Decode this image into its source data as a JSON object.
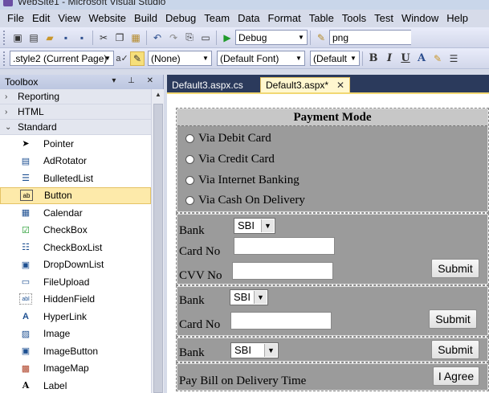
{
  "window": {
    "title": "WebSite1 - Microsoft Visual Studio"
  },
  "menu": [
    "File",
    "Edit",
    "View",
    "Website",
    "Build",
    "Debug",
    "Team",
    "Data",
    "Format",
    "Table",
    "Tools",
    "Test",
    "Window",
    "Help"
  ],
  "toolbar1": {
    "configuration": "Debug",
    "find": "png"
  },
  "toolbar2": {
    "style": ".style2 (Current Page)",
    "block_format": "(None)",
    "font": "(Default Font)",
    "size": "(Default"
  },
  "toolbox": {
    "title": "Toolbox",
    "categories": [
      "Reporting",
      "HTML",
      "Standard"
    ],
    "items": [
      "Pointer",
      "AdRotator",
      "BulletedList",
      "Button",
      "Calendar",
      "CheckBox",
      "CheckBoxList",
      "DropDownList",
      "FileUpload",
      "HiddenField",
      "HyperLink",
      "Image",
      "ImageButton",
      "ImageMap",
      "Label"
    ]
  },
  "tabs": {
    "inactive": "Default3.aspx.cs",
    "active": "Default3.aspx*"
  },
  "form": {
    "header": "Payment Mode",
    "options": [
      "Via Debit Card",
      "Via Credit Card",
      "Via Internet Banking",
      "Via Cash On Delivery"
    ],
    "bank_label": "Bank",
    "bank_value": "SBI",
    "card_no_label": "Card No",
    "cvv_label": "CVV No",
    "submit": "Submit",
    "pay_on_delivery": "Pay Bill on Delivery Time",
    "agree": "I Agree"
  }
}
